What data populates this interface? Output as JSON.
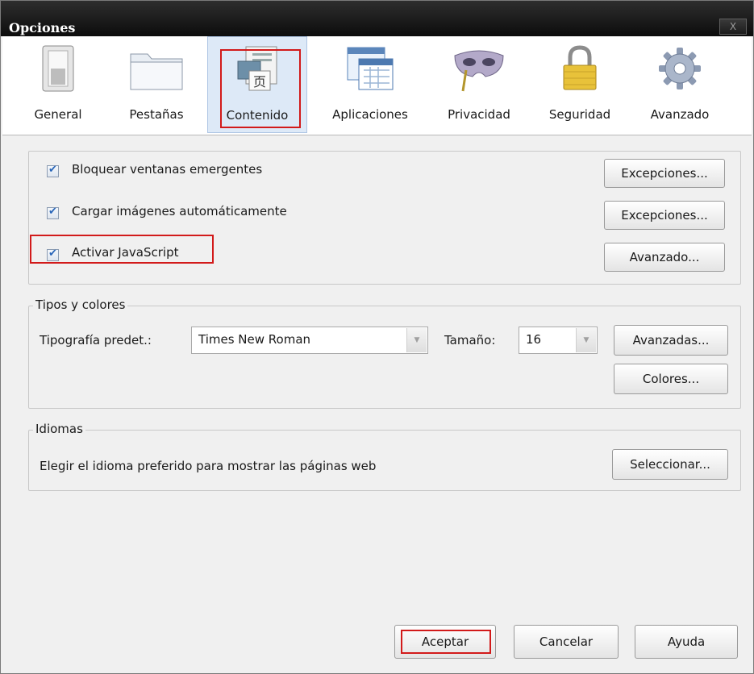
{
  "window": {
    "title": "Opciones",
    "close_label": "X"
  },
  "tabs": [
    {
      "label": "General",
      "icon": "general-icon"
    },
    {
      "label": "Pestañas",
      "icon": "folder-tabs-icon"
    },
    {
      "label": "Contenido",
      "icon": "content-icon",
      "selected": true
    },
    {
      "label": "Aplicaciones",
      "icon": "applications-icon"
    },
    {
      "label": "Privacidad",
      "icon": "mask-icon"
    },
    {
      "label": "Seguridad",
      "icon": "padlock-icon"
    },
    {
      "label": "Avanzado",
      "icon": "gear-icon"
    }
  ],
  "content": {
    "block_popups": {
      "label": "Bloquear ventanas emergentes",
      "checked": true,
      "button": "Excepciones..."
    },
    "load_images": {
      "label": "Cargar imágenes automáticamente",
      "checked": true,
      "button": "Excepciones..."
    },
    "javascript": {
      "label": "Activar JavaScript",
      "checked": true,
      "button": "Avanzado..."
    }
  },
  "fonts": {
    "legend": "Tipos y colores",
    "default_font_label": "Tipografía predet.:",
    "default_font_value": "Times New Roman",
    "size_label": "Tamaño:",
    "size_value": "16",
    "advanced_button": "Avanzadas...",
    "colors_button": "Colores..."
  },
  "languages": {
    "legend": "Idiomas",
    "text": "Elegir el idioma preferido para mostrar las páginas web",
    "choose_button": "Seleccionar..."
  },
  "footer": {
    "ok": "Aceptar",
    "cancel": "Cancelar",
    "help": "Ayuda"
  },
  "colors": {
    "highlight": "#d21a1a",
    "selected_tab": "#dde9f7",
    "title_bar": "#1a1a1a"
  }
}
